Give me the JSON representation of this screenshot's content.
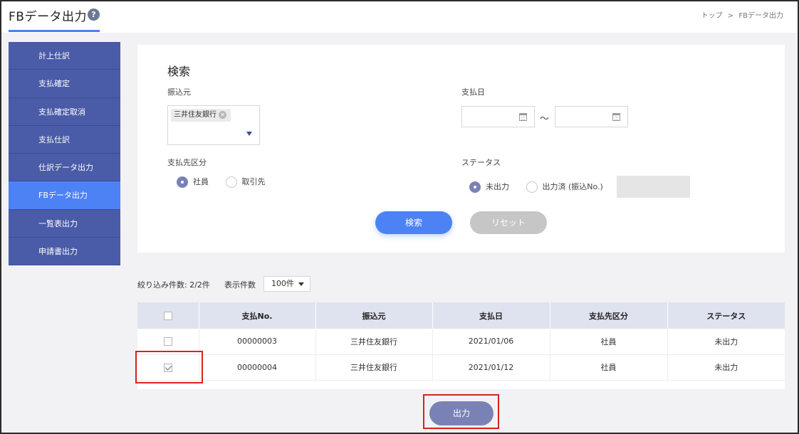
{
  "header": {
    "title": "FBデータ出力",
    "help_icon": "question-circle-icon",
    "breadcrumb": [
      "トップ",
      ">",
      "FBデータ出力"
    ]
  },
  "sidebar": {
    "items": [
      {
        "label": "計上仕訳",
        "active": false
      },
      {
        "label": "支払確定",
        "active": false
      },
      {
        "label": "支払確定取消",
        "active": false
      },
      {
        "label": "支払仕訳",
        "active": false
      },
      {
        "label": "仕訳データ出力",
        "active": false
      },
      {
        "label": "FBデータ出力",
        "active": true
      },
      {
        "label": "一覧表出力",
        "active": false
      },
      {
        "label": "申請書出力",
        "active": false
      }
    ]
  },
  "search": {
    "title": "検索",
    "source_label": "振込元",
    "source_chip": "三井住友銀行",
    "payment_date_label": "支払日",
    "date_separator": "～",
    "date_from": "",
    "date_to": "",
    "payee_type_label": "支払先区分",
    "payee_options": [
      "社員",
      "取引先"
    ],
    "payee_selected": "社員",
    "status_label": "ステータス",
    "status_options": [
      "未出力",
      "出力済 (振込No.)"
    ],
    "status_selected": "未出力",
    "search_button": "検索",
    "reset_button": "リセット"
  },
  "results": {
    "count_text": "絞り込み件数: 2/2件",
    "page_size_label": "表示件数",
    "page_size_value": "100件"
  },
  "table": {
    "columns": [
      "支払No.",
      "振込元",
      "支払日",
      "支払先区分",
      "ステータス"
    ],
    "rows": [
      {
        "checked": false,
        "cells": [
          "00000003",
          "三井住友銀行",
          "2021/01/06",
          "社員",
          "未出力"
        ]
      },
      {
        "checked": true,
        "cells": [
          "00000004",
          "三井住友銀行",
          "2021/01/12",
          "社員",
          "未出力"
        ]
      }
    ]
  },
  "output_button": "出力",
  "colors": {
    "accent": "#4d82f5",
    "sidebar": "#4a5ba8",
    "output_button": "#7a82b5",
    "highlight": "#d9221f"
  }
}
